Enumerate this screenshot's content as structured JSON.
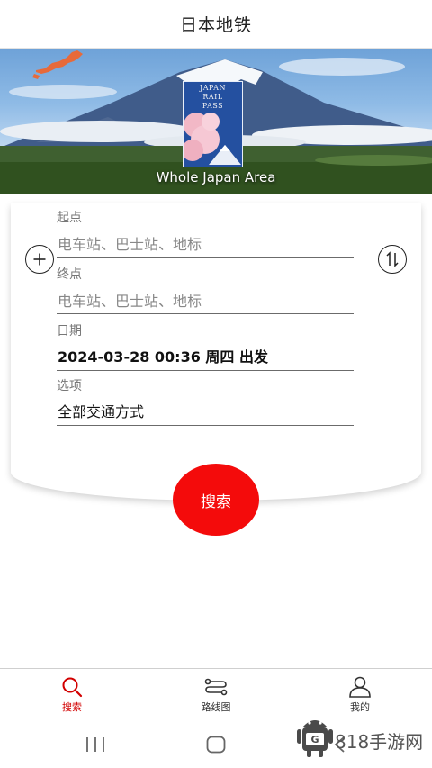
{
  "header": {
    "title": "日本地铁"
  },
  "banner": {
    "caption": "Whole Japan Area",
    "pass_lines": [
      "JAPAN",
      "RAIL",
      "PASS"
    ]
  },
  "search": {
    "origin": {
      "label": "起点",
      "placeholder": "电车站、巴士站、地标"
    },
    "destination": {
      "label": "终点",
      "placeholder": "电车站、巴士站、地标"
    },
    "date": {
      "label": "日期",
      "value": "2024-03-28 00:36 周四 出发"
    },
    "options": {
      "label": "选项",
      "value": "全部交通方式"
    },
    "add_icon": "plus-circle-icon",
    "swap_icon": "swap-vertical-icon",
    "button_label": "搜索"
  },
  "tabs": [
    {
      "label": "搜索",
      "icon": "search-icon",
      "active": true
    },
    {
      "label": "路线图",
      "icon": "route-icon",
      "active": false
    },
    {
      "label": "我的",
      "icon": "user-icon",
      "active": false
    }
  ],
  "system_nav": {
    "icons": [
      "recents-icon",
      "home-icon",
      "back-icon"
    ]
  },
  "watermark": {
    "text": "818手游网"
  },
  "colors": {
    "accent": "#f40b0b",
    "active_tab": "#d20000",
    "divider": "#6b6b6b"
  }
}
